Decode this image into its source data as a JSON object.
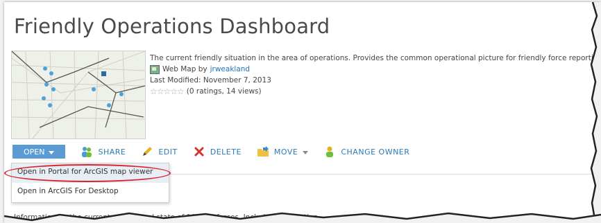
{
  "title": "Friendly Operations Dashboard",
  "description": "The current friendly situation in the area of operations. Provides the common operational picture for friendly force reporting",
  "item_type": "Web Map by",
  "owner": "jrweakland",
  "modified": "Last Modified: November 7, 2013",
  "stars": "☆☆☆☆☆",
  "ratings": "(0 ratings, 14 views)",
  "toolbar": {
    "open": "OPEN",
    "share": "SHARE",
    "edit": "EDIT",
    "delete": "DELETE",
    "move": "MOVE",
    "change_owner": "CHANGE OWNER"
  },
  "menu": {
    "items": [
      "Open in Portal for ArcGIS map viewer",
      "Open in ArcGIS For Desktop"
    ]
  },
  "body_text": "Information on the current operational state of friendly forces. Includes information",
  "colors": {
    "accent": "#5b9bd5",
    "link": "#1e73be",
    "highlight": "#d9232e"
  }
}
